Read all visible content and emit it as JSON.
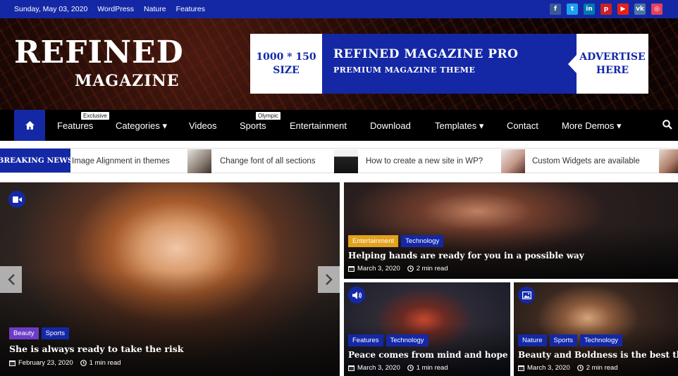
{
  "topbar": {
    "date": "Sunday, May 03, 2020",
    "links": [
      "WordPress",
      "Nature",
      "Features"
    ],
    "socials": [
      {
        "icon": "facebook-icon",
        "glyph": "f",
        "color": "#3b5998"
      },
      {
        "icon": "twitter-icon",
        "glyph": "t",
        "color": "#1da1f2"
      },
      {
        "icon": "linkedin-icon",
        "glyph": "in",
        "color": "#0077b5"
      },
      {
        "icon": "pinterest-icon",
        "glyph": "p",
        "color": "#cb2027"
      },
      {
        "icon": "youtube-icon",
        "glyph": "▶",
        "color": "#e62117"
      },
      {
        "icon": "vk-icon",
        "glyph": "vk",
        "color": "#4c75a3"
      },
      {
        "icon": "instagram-icon",
        "glyph": "◎",
        "color": "#e4405f"
      }
    ]
  },
  "logo": {
    "line1": "REFINED",
    "line2": "MAGAZINE"
  },
  "ad": {
    "size_line1": "1000 * 150",
    "size_line2": "SIZE",
    "title": "REFINED MAGAZINE PRO",
    "subtitle": "PREMIUM MAGAZINE THEME",
    "cta_line1": "ADVERTISE",
    "cta_line2": "HERE"
  },
  "nav": {
    "items": [
      {
        "label": "Features",
        "badge": "Exclusive"
      },
      {
        "label": "Categories ▾",
        "badge": ""
      },
      {
        "label": "Videos",
        "badge": ""
      },
      {
        "label": "Sports",
        "badge": "Olympic"
      },
      {
        "label": "Entertainment",
        "badge": ""
      },
      {
        "label": "Download",
        "badge": ""
      },
      {
        "label": "Templates ▾",
        "badge": ""
      },
      {
        "label": "Contact",
        "badge": ""
      },
      {
        "label": "More Demos ▾",
        "badge": ""
      }
    ]
  },
  "ticker": {
    "label": "BREAKING NEWS",
    "items": [
      "Image Alignment in themes",
      "Change font of all sections",
      "How to create a new site in WP?",
      "Custom Widgets are available"
    ]
  },
  "colors": {
    "accent": "#1428a6",
    "orange": "#e2a21b",
    "purple": "#6d3cc7"
  },
  "cards": {
    "main": {
      "format_icon": "video-icon",
      "cats": [
        "Beauty",
        "Sports"
      ],
      "title": "She is always ready to take the risk",
      "date": "February 23, 2020",
      "read": "1 min read"
    },
    "top": {
      "cats": [
        "Entertainment",
        "Technology"
      ],
      "title": "Helping hands are ready for you in a possible way",
      "date": "March 3, 2020",
      "read": "2 min read"
    },
    "bl": {
      "format_icon": "audio-icon",
      "cats": [
        "Features",
        "Technology"
      ],
      "title": "Peace comes from mind and hope",
      "date": "March 3, 2020",
      "read": "1 min read"
    },
    "br": {
      "format_icon": "image-icon",
      "cats": [
        "Nature",
        "Sports",
        "Technology"
      ],
      "title": "Beauty and Boldness is the best thing today",
      "date": "March 3, 2020",
      "read": "2 min read"
    }
  }
}
